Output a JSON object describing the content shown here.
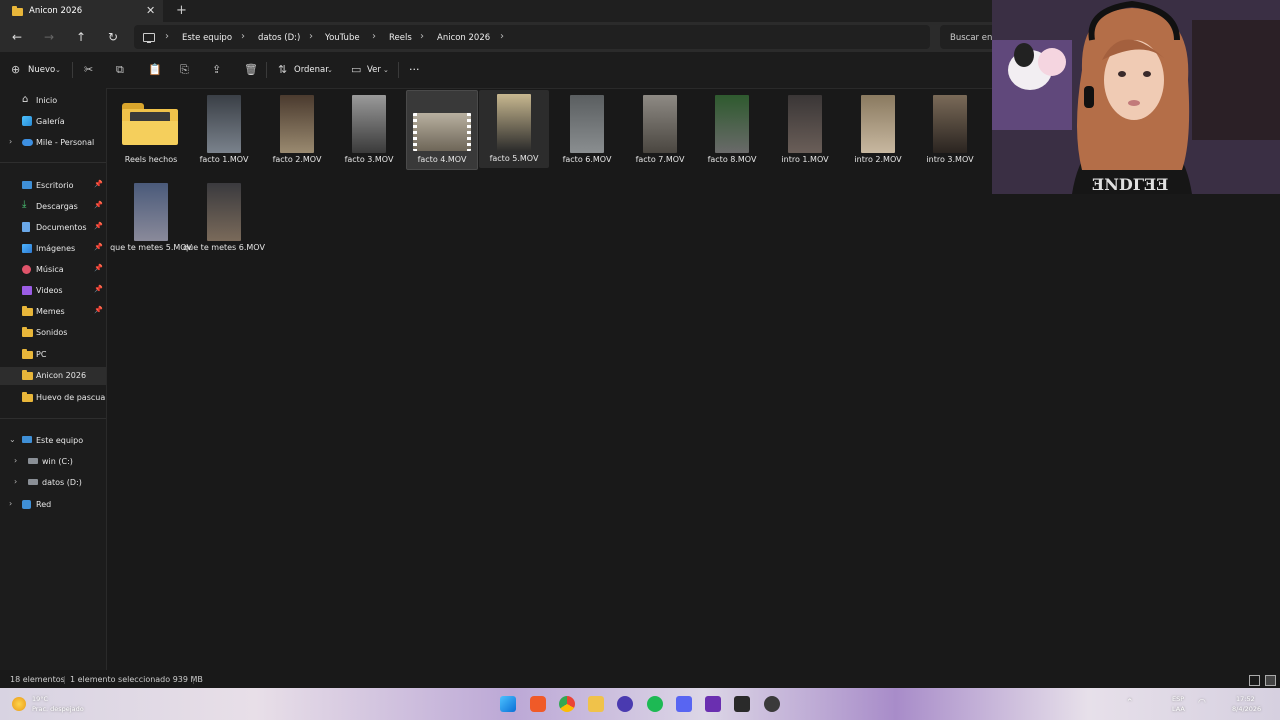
{
  "window": {
    "tab_title": "Anicon 2026",
    "tab_close": "✕",
    "new_tab": "+"
  },
  "address_bar": {
    "breadcrumbs": [
      "Este equipo",
      "datos (D:)",
      "YouTube",
      "Reels",
      "Anicon 2026"
    ],
    "search_placeholder": "Buscar en"
  },
  "toolbar": {
    "new_label": "Nuevo",
    "sort_label": "Ordenar",
    "view_label": "Ver",
    "more_label": "···"
  },
  "sidebar": {
    "top": [
      {
        "label": "Inicio",
        "icon": "home-icon"
      },
      {
        "label": "Galería",
        "icon": "gallery-icon"
      },
      {
        "label": "Mile - Personal",
        "icon": "cloud-icon"
      }
    ],
    "quick_access": [
      {
        "label": "Escritorio",
        "icon": "desktop-icon",
        "pinned": true
      },
      {
        "label": "Descargas",
        "icon": "download-icon",
        "pinned": true
      },
      {
        "label": "Documentos",
        "icon": "document-icon",
        "pinned": true
      },
      {
        "label": "Imágenes",
        "icon": "image-icon",
        "pinned": true
      },
      {
        "label": "Música",
        "icon": "music-icon",
        "pinned": true
      },
      {
        "label": "Videos",
        "icon": "video-icon",
        "pinned": true
      },
      {
        "label": "Memes",
        "icon": "folder-icon",
        "pinned": true
      },
      {
        "label": "Sonidos",
        "icon": "folder-icon",
        "pinned": false
      },
      {
        "label": "PC",
        "icon": "folder-icon",
        "pinned": false
      },
      {
        "label": "Anicon 2026",
        "icon": "folder-icon",
        "pinned": false,
        "selected": true
      },
      {
        "label": "Huevo de pascua",
        "icon": "folder-icon",
        "pinned": false
      }
    ],
    "this_pc": {
      "label": "Este equipo",
      "icon": "pc-icon"
    },
    "drives": [
      {
        "label": "win (C:)",
        "icon": "drive-icon"
      },
      {
        "label": "datos (D:)",
        "icon": "drive-icon"
      }
    ],
    "network": {
      "label": "Red",
      "icon": "network-icon"
    }
  },
  "files": [
    {
      "name": "Reels hechos",
      "type": "folder"
    },
    {
      "name": "facto 1.MOV",
      "type": "video",
      "colors": [
        "#3a3f46",
        "#7a828c"
      ]
    },
    {
      "name": "facto 2.MOV",
      "type": "video",
      "colors": [
        "#4a3a2e",
        "#9a8a70"
      ]
    },
    {
      "name": "facto 3.MOV",
      "type": "video",
      "colors": [
        "#9a9a9a",
        "#3a3a3a"
      ]
    },
    {
      "name": "facto 4.MOV",
      "type": "video",
      "selected": true,
      "colors": [
        "#b8b0a0",
        "#6e6658"
      ]
    },
    {
      "name": "facto 5.MOV",
      "type": "video",
      "hover": true,
      "colors": [
        "#c8b890",
        "#2a2a2a"
      ]
    },
    {
      "name": "facto 6.MOV",
      "type": "video",
      "colors": [
        "#5a5e60",
        "#8a8e90"
      ]
    },
    {
      "name": "facto 7.MOV",
      "type": "video",
      "colors": [
        "#8e8a84",
        "#4a4640"
      ]
    },
    {
      "name": "facto 8.MOV",
      "type": "video",
      "colors": [
        "#2e5a2e",
        "#6a6a6a"
      ]
    },
    {
      "name": "intro 1.MOV",
      "type": "video",
      "colors": [
        "#3a3636",
        "#6a5e58"
      ]
    },
    {
      "name": "intro 2.MOV",
      "type": "video",
      "colors": [
        "#8a7a60",
        "#c8b8a0"
      ]
    },
    {
      "name": "intro 3.MOV",
      "type": "video",
      "colors": [
        "#7a6a58",
        "#2a2420"
      ]
    },
    {
      "name": "que te metes 5.MOV",
      "type": "video",
      "colors": [
        "#4a5a7a",
        "#8a8a9a"
      ]
    },
    {
      "name": "que te metes 6.MOV",
      "type": "video",
      "colors": [
        "#3a3a3e",
        "#7a6a5a"
      ]
    }
  ],
  "status_bar": {
    "count": "18 elementos",
    "selection": "1 elemento seleccionado  939 MB"
  },
  "taskbar": {
    "weather_temp": "19°C",
    "weather_desc": "Prac. despejado",
    "lang_top": "ESP",
    "lang_bottom": "LAA",
    "time": "17:52",
    "date": "8/4/2026"
  },
  "colors": {
    "folder": "#f0c24a",
    "accent": "#4cc2ff",
    "background": "#191919"
  }
}
